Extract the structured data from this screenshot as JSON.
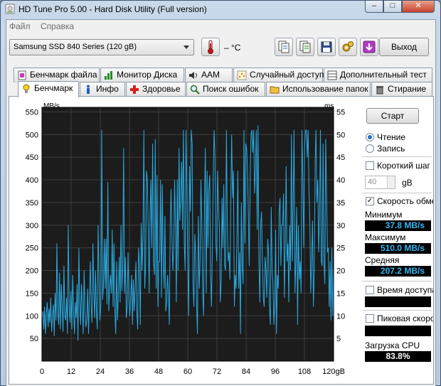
{
  "window": {
    "title": "HD Tune Pro 5.00 - Hard Disk Utility (Full  version)"
  },
  "menu": {
    "file": "Файл",
    "help": "Справка"
  },
  "toolbar": {
    "drive": "Samsung SSD 840 Series (120 gB)",
    "temperature": "– °C",
    "exit": "Выход"
  },
  "tabs_top": [
    "Бенчмарк файла",
    "Монитор Диска",
    "AAM",
    "Случайный доступ",
    "Дополнительный  тест"
  ],
  "tabs_bottom": [
    "Бенчмарк",
    "Инфо",
    "Здоровье",
    "Поиск ошибок",
    "Использование папок",
    "Стирание"
  ],
  "side": {
    "start": "Старт",
    "read": "Чтение",
    "write": "Запись",
    "short_stroke": "Короткий шаг",
    "short_stroke_value": "40",
    "short_stroke_unit": "gB",
    "transfer_rate": "Скорость обмена",
    "min_label": "Минимум",
    "min_value": "37.8 MB/s",
    "max_label": "Максимум",
    "max_value": "510.0 MB/s",
    "avg_label": "Средняя",
    "avg_value": "207.2 MB/s",
    "access_time": "Время доступа",
    "burst_rate": "Пиковая скорость",
    "cpu_label": "Загрузка CPU",
    "cpu_value": "83.8%"
  },
  "colors": {
    "plot_bg": "#1c1c1c",
    "line": "#29abe2",
    "grid": "#3d3d3d"
  },
  "chart_data": {
    "type": "line",
    "ylabel_left": "MB/s",
    "ylabel_right": "ms",
    "y_ticks_left": [
      "550",
      "500",
      "450",
      "400",
      "350",
      "300",
      "250",
      "200",
      "150",
      "100",
      "50"
    ],
    "y_ticks_right": [
      "55",
      "50",
      "45",
      "40",
      "35",
      "30",
      "25",
      "20",
      "15",
      "10",
      "5"
    ],
    "x_ticks": [
      "0",
      "12",
      "24",
      "36",
      "48",
      "60",
      "72",
      "84",
      "96",
      "108",
      "120gB"
    ],
    "xlim": [
      0,
      120
    ],
    "ylim": [
      0,
      560
    ],
    "grid": true,
    "series": [
      {
        "values": [
          95,
          110,
          70,
          120,
          60,
          105,
          130,
          75,
          115,
          85,
          140,
          65,
          100,
          125,
          55,
          150,
          90,
          260,
          110,
          80,
          195,
          70,
          170,
          120,
          65,
          210,
          100,
          90,
          140,
          60,
          300,
          120,
          85,
          155,
          70,
          190,
          110,
          60,
          130,
          95,
          170,
          45,
          250,
          130,
          80,
          170,
          120,
          60,
          200,
          110,
          75,
          90,
          160,
          60,
          140,
          220,
          120,
          85,
          260,
          150,
          95,
          200,
          110,
          70,
          300,
          170,
          90,
          120,
          510,
          135,
          165,
          270,
          160,
          270,
          125,
          395,
          110,
          160,
          190,
          150,
          290,
          120,
          260,
          110,
          60,
          220,
          90,
          150,
          230,
          130,
          300,
          155,
          210,
          470,
          150,
          230,
          95,
          120,
          240,
          135,
          100,
          140,
          190,
          80,
          180,
          110,
          160,
          220,
          110,
          70,
          250,
          210,
          80,
          305,
          200,
          280,
          510,
          160,
          210,
          420,
          400,
          290,
          150,
          320,
          400,
          250,
          480,
          220,
          190,
          490,
          160,
          410,
          120,
          220,
          220,
          400,
          140,
          390,
          230,
          160,
          320,
          110,
          130,
          190,
          150,
          80,
          300,
          380,
          270,
          200,
          250,
          400,
          300,
          130,
          400,
          200,
          470,
          310,
          360,
          440,
          290,
          510,
          260,
          200,
          510,
          380,
          210,
          100,
          430,
          330,
          510,
          480,
          170,
          120,
          280,
          240,
          130,
          60,
          320,
          160,
          220,
          400,
          300,
          150,
          100,
          350,
          470,
          150,
          420,
          250,
          380,
          410,
          190,
          120,
          250,
          400,
          510,
          450,
          260,
          220,
          420,
          340,
          290,
          130,
          170,
          360,
          250,
          390,
          210,
          200,
          510,
          300,
          220,
          240,
          180,
          360,
          500,
          360,
          420,
          120,
          190,
          160,
          280,
          420,
          160,
          240,
          60,
          350,
          210,
          170,
          510,
          260,
          480,
          470,
          420,
          320,
          210,
          400,
          500,
          510,
          460,
          510,
          370,
          420,
          510,
          290,
          520,
          220,
          130,
          300,
          330,
          220,
          140,
          120,
          230,
          200,
          140,
          270,
          240,
          120,
          80,
          340,
          200,
          170,
          80,
          130,
          290,
          60,
          190,
          160,
          330,
          360,
          210,
          300,
          300,
          370,
          140,
          270,
          430,
          220,
          260,
          130,
          300,
          200,
          500,
          220,
          350,
          510,
          150,
          220,
          340,
          80,
          300,
          180,
          220,
          150,
          510,
          400,
          250,
          470,
          510,
          510,
          450,
          510,
          380,
          300,
          150,
          220,
          310,
          120,
          200,
          440,
          510,
          350,
          400,
          240,
          320,
          510,
          220,
          210,
          480,
          220,
          170,
          490,
          380,
          240,
          250,
          120,
          220,
          90,
          250,
          100,
          210
        ]
      }
    ]
  }
}
